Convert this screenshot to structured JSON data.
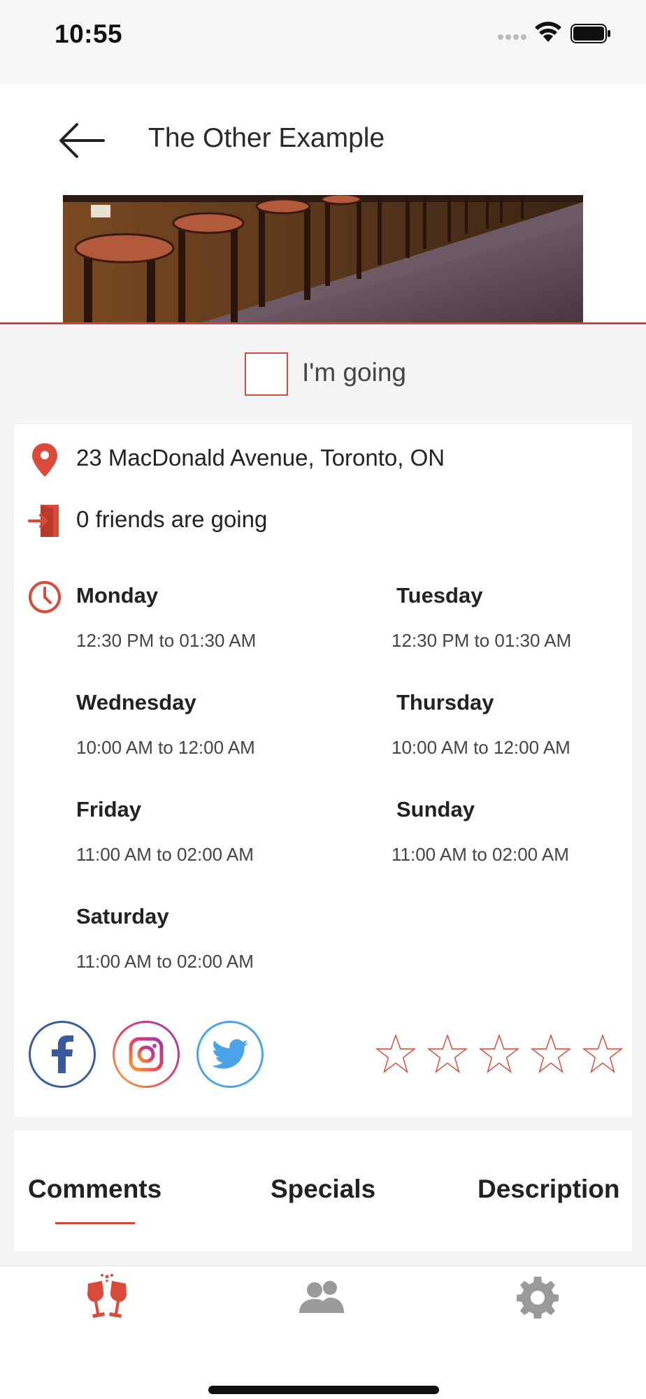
{
  "status_bar": {
    "time": "10:55"
  },
  "header": {
    "title": "The Other Example"
  },
  "going": {
    "label": "I'm going",
    "checked": false
  },
  "info": {
    "address": "23 MacDonald Avenue, Toronto, ON",
    "friends": "0 friends are going"
  },
  "hours": [
    {
      "day": "Monday",
      "hours": "12:30 PM to 01:30 AM"
    },
    {
      "day": "Tuesday",
      "hours": "12:30 PM to 01:30 AM"
    },
    {
      "day": "Wednesday",
      "hours": "10:00 AM to 12:00 AM"
    },
    {
      "day": "Thursday",
      "hours": "10:00 AM to 12:00 AM"
    },
    {
      "day": "Friday",
      "hours": "11:00 AM to 02:00 AM"
    },
    {
      "day": "Sunday",
      "hours": "11:00 AM to 02:00 AM"
    },
    {
      "day": "Saturday",
      "hours": "11:00 AM to 02:00 AM"
    }
  ],
  "social": [
    "facebook-icon",
    "instagram-icon",
    "twitter-icon"
  ],
  "rating": {
    "value": 0,
    "max": 5
  },
  "tabs": [
    {
      "label": "Comments",
      "active": true
    },
    {
      "label": "Specials",
      "active": false
    },
    {
      "label": "Description",
      "active": false
    }
  ],
  "bottom_nav": [
    {
      "icon": "wine-glasses-icon",
      "active": true
    },
    {
      "icon": "people-icon",
      "active": false
    },
    {
      "icon": "gear-icon",
      "active": false
    }
  ],
  "colors": {
    "accent": "#d94a3b",
    "facebook": "#3a5aa0",
    "twitter": "#4aa3e8",
    "inactive": "#9a9a9a"
  }
}
